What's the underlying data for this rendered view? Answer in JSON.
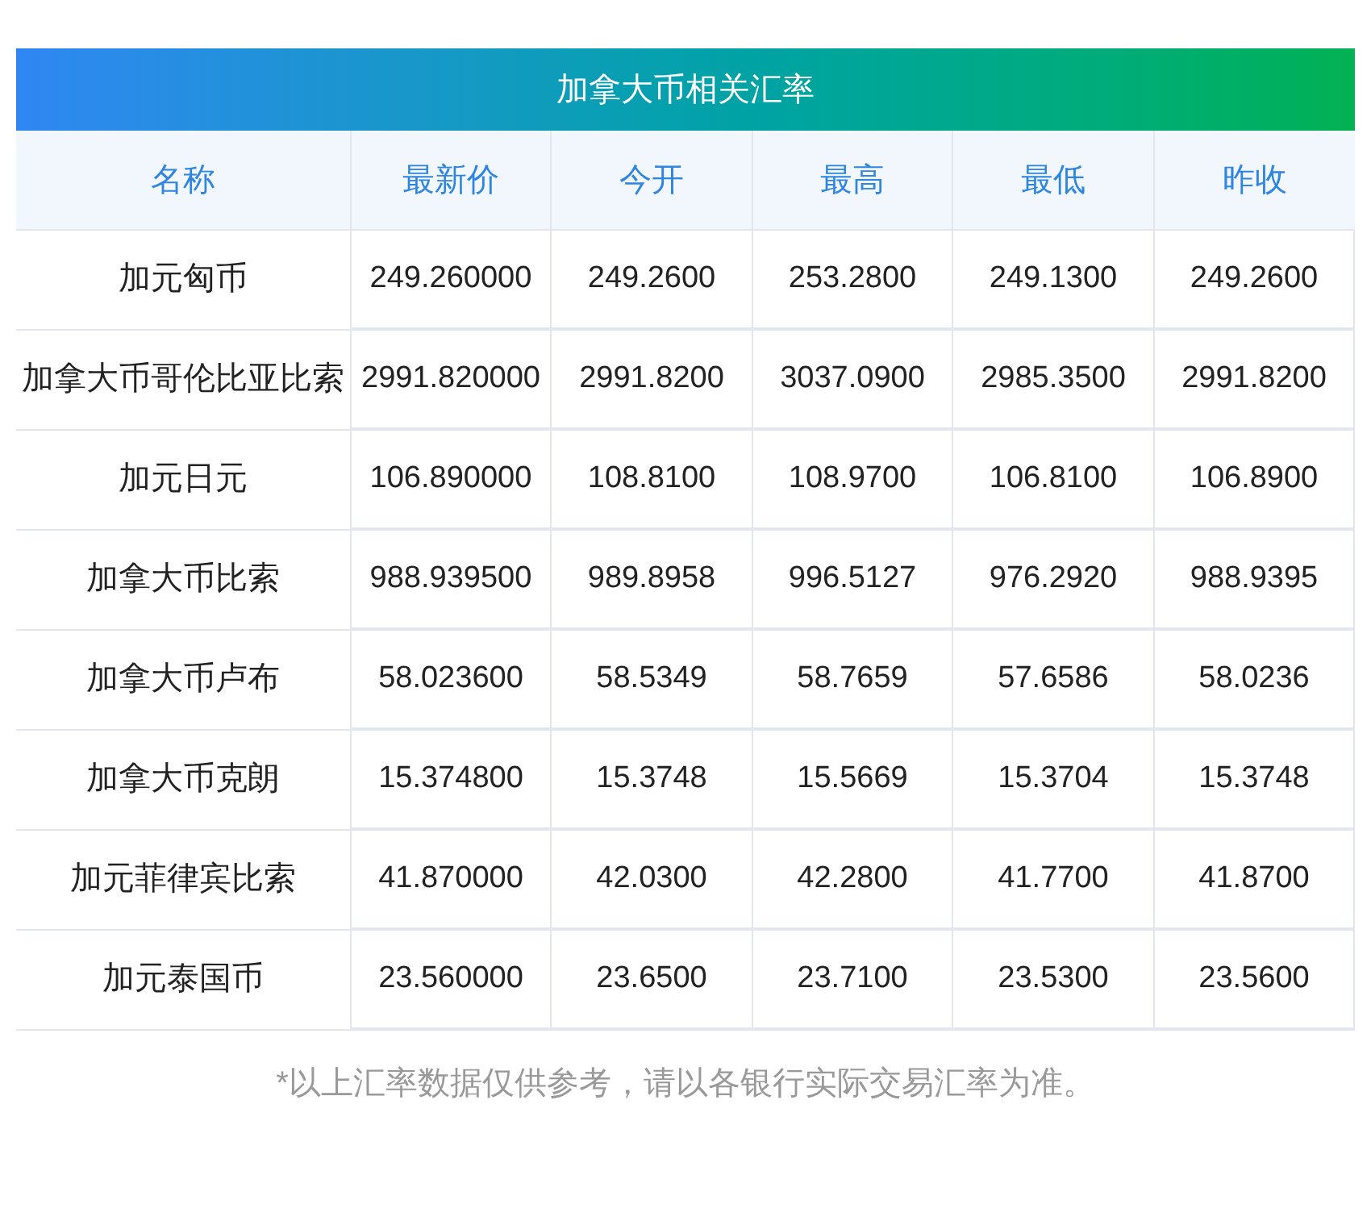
{
  "title": "加拿大币相关汇率",
  "columns": [
    "名称",
    "最新价",
    "今开",
    "最高",
    "最低",
    "昨收"
  ],
  "rows": [
    {
      "name": "加元匈币",
      "values": [
        "249.260000",
        "249.2600",
        "253.2800",
        "249.1300",
        "249.2600"
      ]
    },
    {
      "name": "加拿大币哥伦比亚比索",
      "values": [
        "2991.820000",
        "2991.8200",
        "3037.0900",
        "2985.3500",
        "2991.8200"
      ]
    },
    {
      "name": "加元日元",
      "values": [
        "106.890000",
        "108.8100",
        "108.9700",
        "106.8100",
        "106.8900"
      ]
    },
    {
      "name": "加拿大币比索",
      "values": [
        "988.939500",
        "989.8958",
        "996.5127",
        "976.2920",
        "988.9395"
      ]
    },
    {
      "name": "加拿大币卢布",
      "values": [
        "58.023600",
        "58.5349",
        "58.7659",
        "57.6586",
        "58.0236"
      ]
    },
    {
      "name": "加拿大币克朗",
      "values": [
        "15.374800",
        "15.3748",
        "15.5669",
        "15.3704",
        "15.3748"
      ]
    },
    {
      "name": "加元菲律宾比索",
      "values": [
        "41.870000",
        "42.0300",
        "42.2800",
        "41.7700",
        "41.8700"
      ]
    },
    {
      "name": "加元泰国币",
      "values": [
        "23.560000",
        "23.6500",
        "23.7100",
        "23.5300",
        "23.5600"
      ]
    }
  ],
  "footnote": "*以上汇率数据仅供参考，请以各银行实际交易汇率为准。"
}
